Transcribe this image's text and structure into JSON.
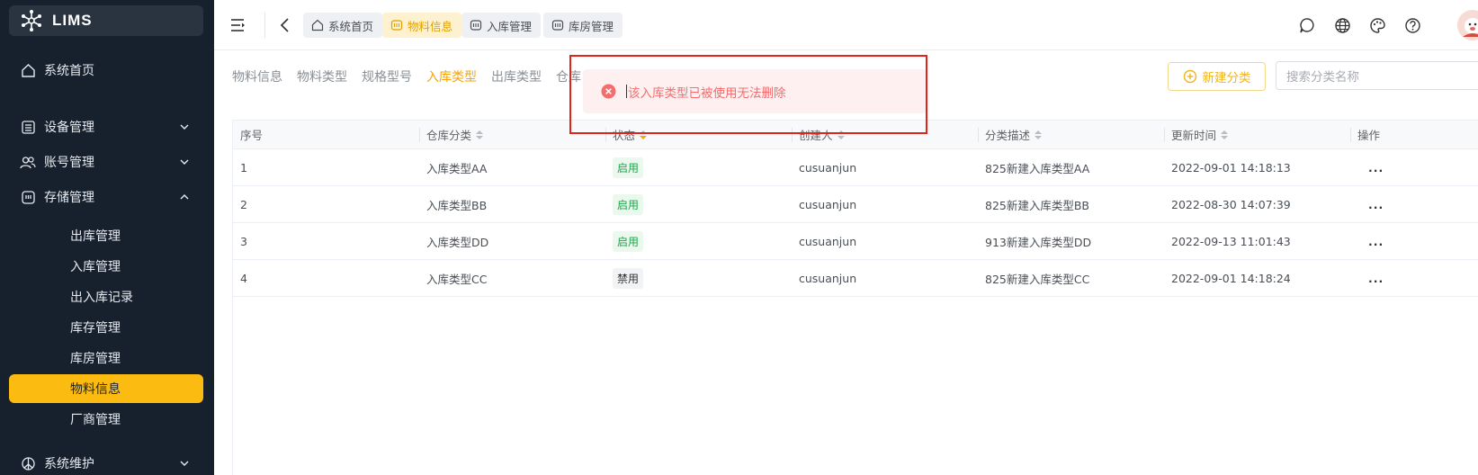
{
  "app": {
    "logo_text": "LIMS"
  },
  "sidebar": {
    "home": "系统首页",
    "groups": [
      {
        "label": "设备管理",
        "expanded": false
      },
      {
        "label": "账号管理",
        "expanded": false
      },
      {
        "label": "存储管理",
        "expanded": true
      }
    ],
    "storage_items": [
      "出库管理",
      "入库管理",
      "出入库记录",
      "库存管理",
      "库房管理",
      "物料信息",
      "厂商管理"
    ],
    "active_item": "物料信息",
    "system": "系统维护"
  },
  "header": {
    "tabs": [
      {
        "label": "系统首页",
        "icon": "home-icon",
        "active": false
      },
      {
        "label": "物料信息",
        "icon": "box-icon",
        "active": true
      },
      {
        "label": "入库管理",
        "icon": "box-icon",
        "active": false
      },
      {
        "label": "库房管理",
        "icon": "box-icon",
        "active": false
      }
    ],
    "right_icons": [
      "message-icon",
      "globe-icon",
      "palette-icon",
      "help-icon"
    ]
  },
  "subtabs": [
    "物料信息",
    "物料类型",
    "规格型号",
    "入库类型",
    "出库类型",
    "仓库"
  ],
  "active_subtab": "入库类型",
  "actions": {
    "new_button": "新建分类",
    "search_placeholder": "搜索分类名称"
  },
  "table": {
    "columns": [
      "序号",
      "仓库分类",
      "状态",
      "创建人",
      "分类描述",
      "更新时间",
      "操作"
    ],
    "rows": [
      {
        "no": "1",
        "category": "入库类型AA",
        "status": "启用",
        "creator": "cusuanjun",
        "desc": "825新建入库类型AA",
        "updated": "2022-09-01 14:18:13",
        "op": "..."
      },
      {
        "no": "2",
        "category": "入库类型BB",
        "status": "启用",
        "creator": "cusuanjun",
        "desc": "825新建入库类型BB",
        "updated": "2022-08-30 14:07:39",
        "op": "..."
      },
      {
        "no": "3",
        "category": "入库类型DD",
        "status": "启用",
        "creator": "cusuanjun",
        "desc": "913新建入库类型DD",
        "updated": "2022-09-13 11:01:43",
        "op": "..."
      },
      {
        "no": "4",
        "category": "入库类型CC",
        "status": "禁用",
        "creator": "cusuanjun",
        "desc": "825新建入库类型CC",
        "updated": "2022-09-01 14:18:24",
        "op": "..."
      }
    ]
  },
  "toast": {
    "message": "该入库类型已被使用无法删除",
    "type": "error"
  },
  "colors": {
    "sidebar_bg": "#17212e",
    "accent": "#fbbb10",
    "error": "#f56c6c",
    "enabled": "#1fa64a"
  }
}
